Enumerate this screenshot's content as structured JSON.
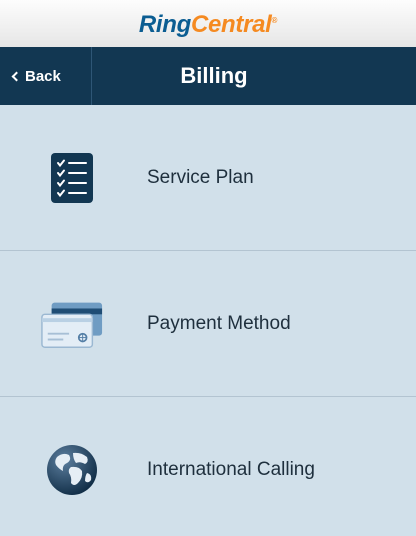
{
  "brand": {
    "name_part1": "Ring",
    "name_part2": "Central",
    "registered_mark": "®",
    "colors": {
      "ring": "#0b5d92",
      "central": "#f58a21"
    }
  },
  "nav": {
    "back_label": "Back",
    "title": "Billing",
    "background": "#123752"
  },
  "menu": {
    "items": [
      {
        "label": "Service Plan",
        "icon": "checklist-icon"
      },
      {
        "label": "Payment Method",
        "icon": "credit-card-icon"
      },
      {
        "label": "International Calling",
        "icon": "globe-icon"
      }
    ]
  }
}
